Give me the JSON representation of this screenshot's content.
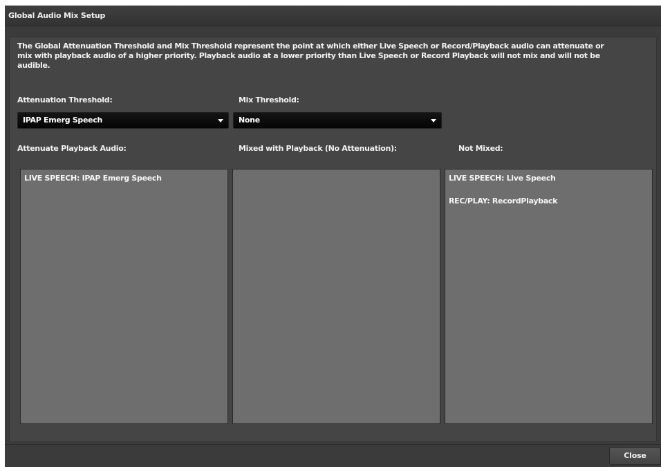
{
  "window": {
    "title": "Global Audio Mix Setup"
  },
  "description": "The Global Attenuation Threshold and Mix Threshold represent the point at which either Live Speech or Record/Playback audio can attenuate or mix with playback audio of a higher priority. Playback audio at a lower priority than Live Speech or Record Playback will not mix and will not be audible.",
  "attenuation": {
    "label": "Attenuation Threshold:",
    "selected": "IPAP Emerg Speech"
  },
  "mix": {
    "label": "Mix Threshold:",
    "selected": "None"
  },
  "columns": {
    "attenuate": {
      "label": "Attenuate Playback Audio:",
      "items": [
        "LIVE SPEECH: IPAP Emerg Speech"
      ]
    },
    "mixed": {
      "label": "Mixed with Playback (No Attenuation):",
      "items": []
    },
    "not_mixed": {
      "label": "Not Mixed:",
      "items": [
        "LIVE SPEECH: Live Speech",
        "REC/PLAY: RecordPlayback"
      ]
    }
  },
  "footer": {
    "close_label": "Close"
  }
}
